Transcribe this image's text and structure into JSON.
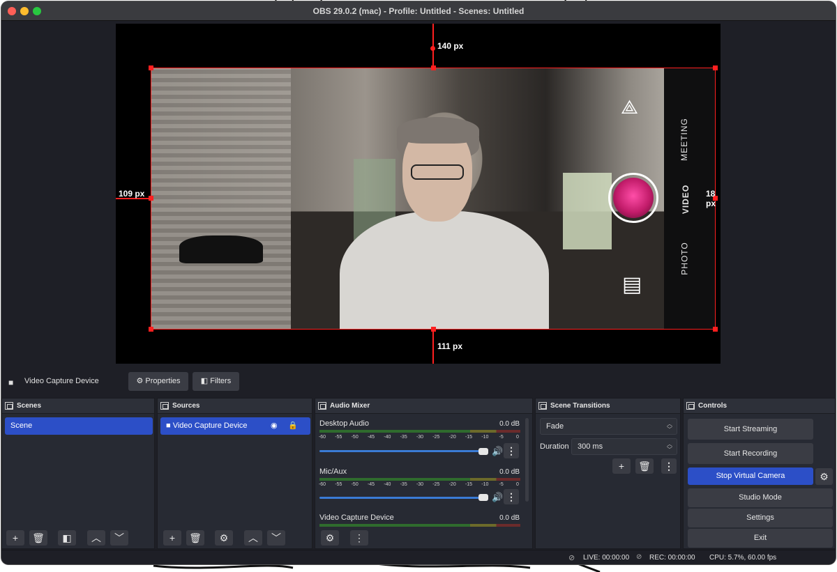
{
  "window": {
    "title": "OBS 29.0.2 (mac) - Profile: Untitled - Scenes: Untitled"
  },
  "preview": {
    "measure_top": "140 px",
    "measure_left": "109 px",
    "measure_right": "18 px",
    "measure_bottom": "111 px",
    "camera_modes": [
      "MEETING",
      "VIDEO",
      "PHOTO"
    ],
    "bbox_color": "#ff1f1f"
  },
  "source_toolbar": {
    "source_name": "Video Capture Device",
    "properties_label": "Properties",
    "filters_label": "Filters"
  },
  "scenes": {
    "title": "Scenes",
    "items": [
      {
        "label": "Scene",
        "selected": true
      }
    ]
  },
  "sources": {
    "title": "Sources",
    "items": [
      {
        "label": "Video Capture Device",
        "selected": true,
        "visible": true,
        "locked": false
      }
    ]
  },
  "audio_mixer": {
    "title": "Audio Mixer",
    "scale_ticks": [
      "-60",
      "-55",
      "-50",
      "-45",
      "-40",
      "-35",
      "-30",
      "-25",
      "-20",
      "-15",
      "-10",
      "-5",
      "0"
    ],
    "channels": [
      {
        "name": "Desktop Audio",
        "db": "0.0 dB",
        "volume": 1.0
      },
      {
        "name": "Mic/Aux",
        "db": "0.0 dB",
        "volume": 1.0
      },
      {
        "name": "Video Capture Device",
        "db": "0.0 dB",
        "volume": 1.0
      }
    ]
  },
  "scene_transitions": {
    "title": "Scene Transitions",
    "transition": "Fade",
    "duration_label": "Duration",
    "duration_value": "300 ms"
  },
  "controls": {
    "title": "Controls",
    "start_streaming": "Start Streaming",
    "start_recording": "Start Recording",
    "stop_virtual_camera": "Stop Virtual Camera",
    "studio_mode": "Studio Mode",
    "settings": "Settings",
    "exit": "Exit",
    "accent_color": "#2c4fc7"
  },
  "status": {
    "live": "LIVE: 00:00:00",
    "rec": "REC: 00:00:00",
    "cpu": "CPU: 5.7%, 60.00 fps"
  },
  "icons": [
    "camera-icon",
    "gear-icon",
    "filter-icon",
    "eye-icon",
    "lock-icon",
    "plus-icon",
    "trash-icon",
    "chevron-up-icon",
    "chevron-down-icon",
    "speaker-icon",
    "kebab-icon",
    "dock-icon",
    "no-network-icon"
  ]
}
